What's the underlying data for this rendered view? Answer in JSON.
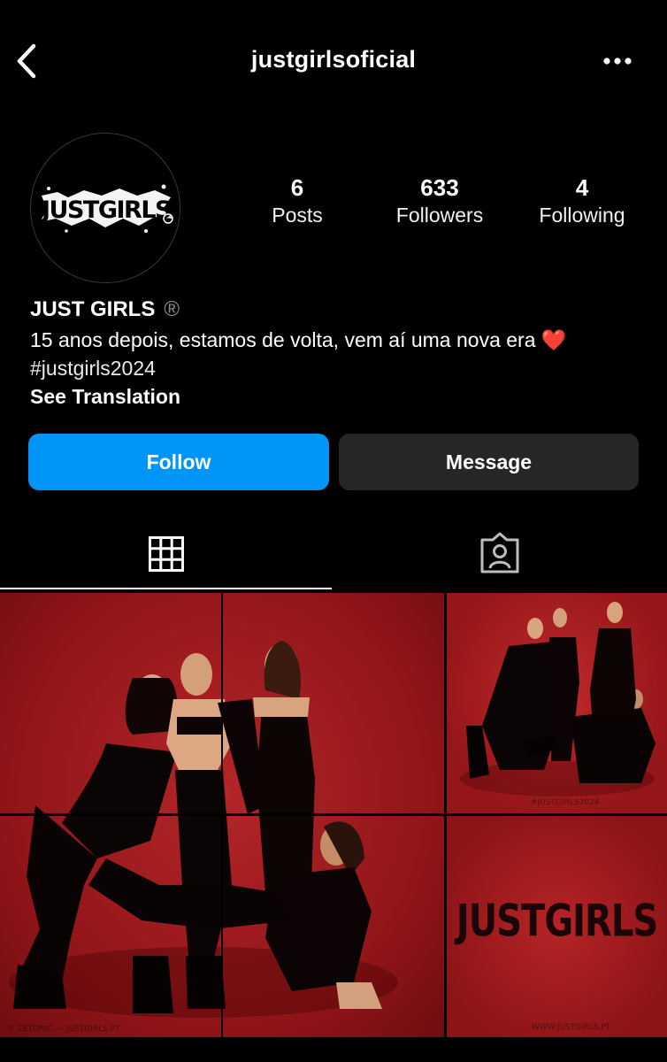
{
  "header": {
    "username": "justgirlsoficial",
    "back_icon": "chevron-left-icon",
    "more_icon": "more-horizontal-icon"
  },
  "profile": {
    "avatar_logo_text": "JUSTGIRLS",
    "stats": [
      {
        "value": "6",
        "label": "Posts"
      },
      {
        "value": "633",
        "label": "Followers"
      },
      {
        "value": "4",
        "label": "Following"
      }
    ],
    "name": "JUST GIRLS",
    "name_mark": "®",
    "bio_line1": "15 anos depois, estamos de volta, vem aí uma nova era",
    "bio_emoji": "❤️",
    "bio_line2": "#justgirls2024",
    "see_translation": "See Translation"
  },
  "actions": {
    "follow_label": "Follow",
    "message_label": "Message",
    "follow_color": "#0095f6",
    "message_color": "#262626"
  },
  "tabs": [
    {
      "name": "grid",
      "icon": "grid-icon",
      "active": true
    },
    {
      "name": "tagged",
      "icon": "tagged-user-icon",
      "active": false
    }
  ],
  "posts": {
    "small2_logo": "JUSTGIRLS",
    "watermark_big": "© ZETONIC — JUSTGIRLS.PT",
    "watermark_small1": "#JUSTGIRLS2024",
    "watermark_small2": "WWW.JUSTGIRLS.PT"
  }
}
